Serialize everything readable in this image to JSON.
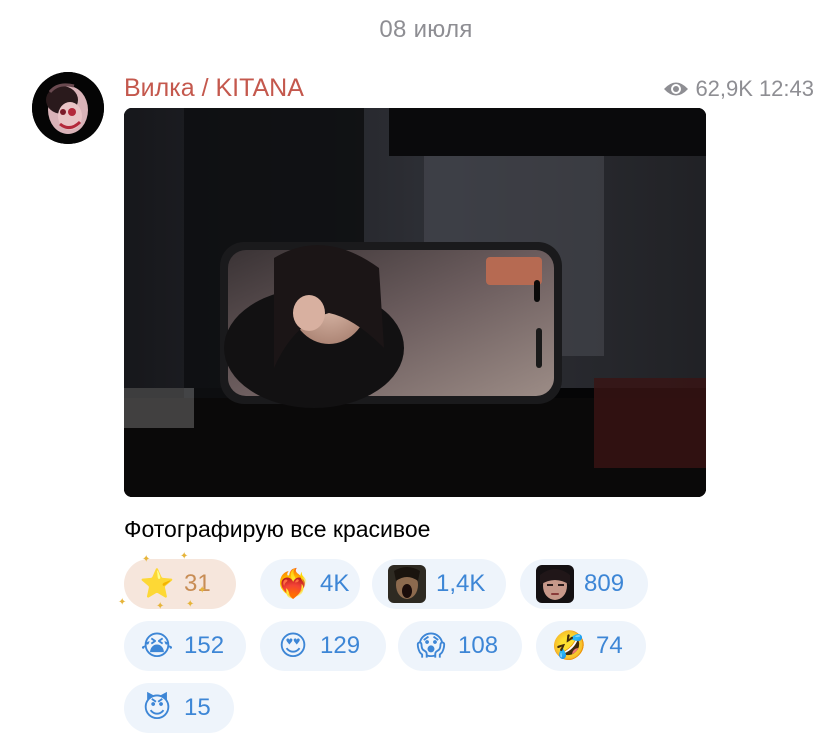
{
  "date_separator": "08 июля",
  "post": {
    "channel_name": "Вилка / KITANA",
    "views": "62,9K",
    "time": "12:43",
    "caption": "Фотографирую все красивое",
    "icons": {
      "views": "eye-icon",
      "avatar": "channel-avatar",
      "photo": "post-photo-phone-on-table"
    }
  },
  "reactions": [
    {
      "emoji": "⭐",
      "name": "star",
      "count": "31",
      "chosen": true
    },
    {
      "emoji": "❤️‍🔥",
      "name": "heart-on-fire",
      "count": "4K"
    },
    {
      "emoji": "",
      "name": "custom-scream-face",
      "count": "1,4K",
      "thumb": "dark"
    },
    {
      "emoji": "",
      "name": "custom-face",
      "count": "809",
      "thumb": "face"
    },
    {
      "emoji": "😭",
      "name": "crying-face",
      "count": "152"
    },
    {
      "emoji": "😍",
      "name": "heart-eyes",
      "count": "129"
    },
    {
      "emoji": "😱",
      "name": "screaming-face",
      "count": "108"
    },
    {
      "emoji": "🤣",
      "name": "rolling-laughing",
      "count": "74"
    },
    {
      "emoji": "😈",
      "name": "smiling-devil",
      "count": "15"
    }
  ],
  "colors": {
    "channel_name": "#c4584d",
    "reaction_text": "#3d86d6",
    "reaction_bg": "#eef4fb",
    "chosen_bg": "#f6e6dc",
    "chosen_text": "#c88d55",
    "meta_text": "#8e8e93"
  }
}
